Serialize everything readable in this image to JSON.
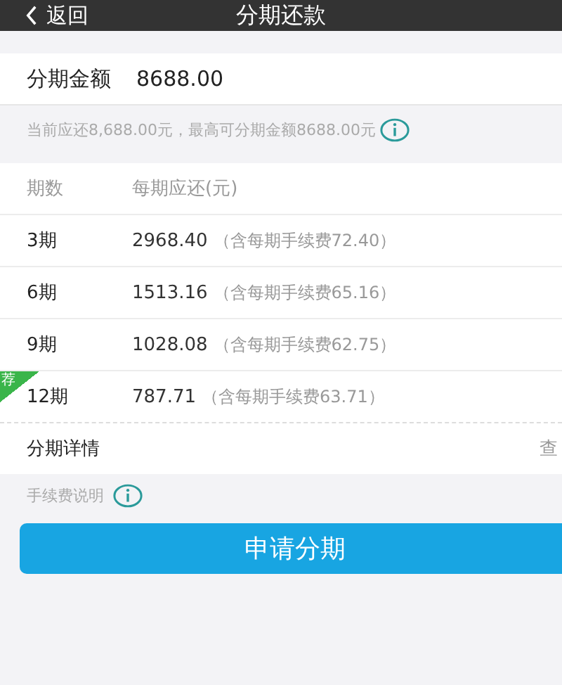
{
  "nav": {
    "back": "返回",
    "title": "分期还款"
  },
  "amount": {
    "label": "分期金额",
    "value": "8688.00"
  },
  "hint": "当前应还8,688.00元，最高可分期金额8688.00元",
  "table": {
    "columns": [
      "期数",
      "每期应还(元)"
    ],
    "rows": [
      {
        "term": "3期",
        "payment": "2968.40",
        "fee": "（含每期手续费72.40）",
        "recommended": false
      },
      {
        "term": "6期",
        "payment": "1513.16",
        "fee": "（含每期手续费65.16）",
        "recommended": false
      },
      {
        "term": "9期",
        "payment": "1028.08",
        "fee": "（含每期手续费62.75）",
        "recommended": false
      },
      {
        "term": "12期",
        "payment": "787.71",
        "fee": "（含每期手续费63.71）",
        "recommended": true,
        "badge": "荐"
      }
    ]
  },
  "details": {
    "label": "分期详情",
    "link": "查"
  },
  "fee_note": "手续费说明",
  "apply_button": "申请分期"
}
